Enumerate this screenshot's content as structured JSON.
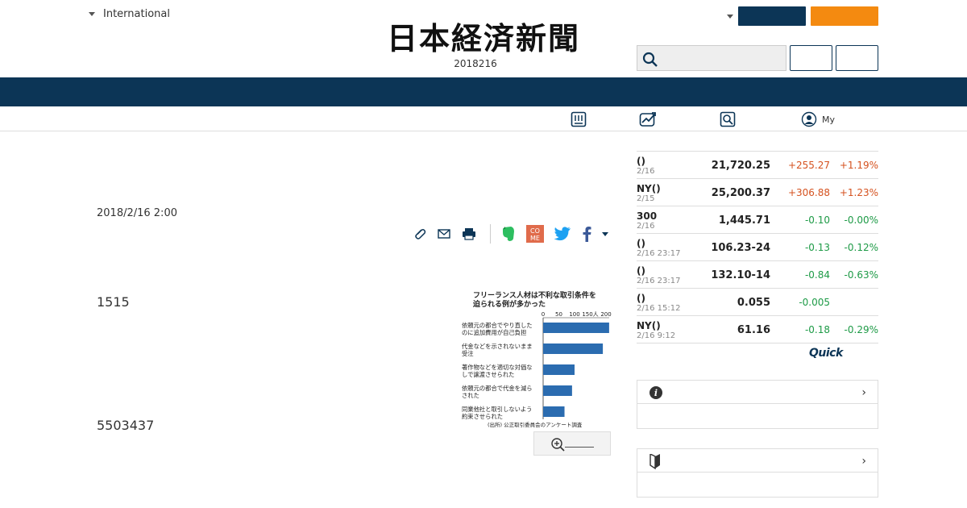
{
  "header": {
    "edition": "International",
    "logo_text": "日本経済新聞",
    "issue_date": "2018216"
  },
  "subnav": {
    "my_label": "My",
    "icons": [
      "newspaper-icon",
      "chart-icon",
      "search-icon",
      "user-icon"
    ]
  },
  "article": {
    "date": "2018/2/16 2:00",
    "paragraph_1": "1515",
    "paragraph_2": "5503437"
  },
  "figure": {
    "title_line1": "フリーランス人材は不利な取引条件を",
    "title_line2": "迫られる例が多かった",
    "source": "(出所) 公正取引委員会のアンケート調査"
  },
  "chart_data": {
    "type": "bar",
    "orientation": "horizontal",
    "title": "フリーランス人材は不利な取引条件を迫られる例が多かった",
    "xlim": [
      0,
      200
    ],
    "xticks": [
      "0",
      "50",
      "100",
      "150人",
      "200"
    ],
    "categories": [
      "依頼元の都合でやり直したのに追加費用が自己負担",
      "代金などを示されないまま受注",
      "著作物などを適切な対価なしで譲渡させられた",
      "依頼元の都合で代金を減らされた",
      "同業他社と取引しないよう約束させられた"
    ],
    "category_lines": [
      [
        "依頼元の都合でやり直した",
        "のに追加費用が自己負担"
      ],
      [
        "代金などを示されないまま",
        "受注"
      ],
      [
        "著作物などを適切な対価な",
        "しで譲渡させられた"
      ],
      [
        "依頼元の都合で代金を減ら",
        "された"
      ],
      [
        "同業他社と取引しないよう",
        "約束させられた"
      ]
    ],
    "values": [
      210,
      190,
      100,
      92,
      68
    ],
    "colors": {
      "bar": "#2b6cb0"
    },
    "source": "(出所) 公正取引委員会のアンケート調査"
  },
  "markets": [
    {
      "name": "()",
      "date": "2/16",
      "value": "21,720.25",
      "change": "+255.27",
      "pct": "+1.19%",
      "dir": "up"
    },
    {
      "name": "NY()",
      "date": "2/15",
      "value": "25,200.37",
      "change": "+306.88",
      "pct": "+1.23%",
      "dir": "up"
    },
    {
      "name": "300",
      "date": "2/16",
      "value": "1,445.71",
      "change": "-0.10",
      "pct": "-0.00%",
      "dir": "down"
    },
    {
      "name": "()",
      "date": "2/16 23:17",
      "value": "106.23-24",
      "change": "-0.13",
      "pct": "-0.12%",
      "dir": "down"
    },
    {
      "name": "()",
      "date": "2/16 23:17",
      "value": "132.10-14",
      "change": "-0.84",
      "pct": "-0.63%",
      "dir": "down"
    },
    {
      "name": "()",
      "date": "2/16 15:12",
      "value": "0.055",
      "change": "-0.005",
      "pct": "",
      "dir": "down"
    },
    {
      "name": "NY()",
      "date": "2/16 9:12",
      "value": "61.16",
      "change": "-0.18",
      "pct": "-0.29%",
      "dir": "down"
    }
  ],
  "quick_logo": "Quick",
  "colors": {
    "navy": "#0c3556",
    "orange": "#f48a10",
    "up": "#d5521f",
    "down": "#1d9a46"
  }
}
